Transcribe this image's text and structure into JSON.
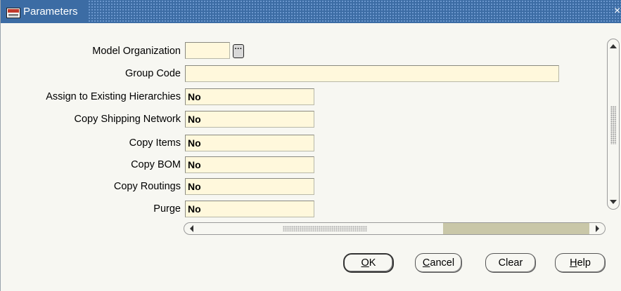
{
  "window": {
    "title": "Parameters",
    "close_glyph": "×",
    "icon": "oracle-forms-icon"
  },
  "form": {
    "model_organization": {
      "label": "Model Organization",
      "value": "",
      "lov_glyph": "···"
    },
    "group_code": {
      "label": "Group Code",
      "value": ""
    },
    "assign_to_existing_hierarchies": {
      "label": "Assign to Existing Hierarchies",
      "value": "No"
    },
    "copy_shipping_network": {
      "label": "Copy Shipping Network",
      "value": "No"
    },
    "copy_items": {
      "label": "Copy Items",
      "value": "No"
    },
    "copy_bom": {
      "label": "Copy BOM",
      "value": "No"
    },
    "copy_routings": {
      "label": "Copy Routings",
      "value": "No"
    },
    "purge": {
      "label": "Purge",
      "value": "No"
    }
  },
  "buttons": {
    "ok": {
      "mnemonic": "O",
      "rest": "K"
    },
    "cancel": {
      "mnemonic": "C",
      "rest": "ancel"
    },
    "clear": {
      "mnemonic": "",
      "rest": "Clear"
    },
    "help": {
      "mnemonic": "H",
      "rest": "elp"
    }
  },
  "colors": {
    "titlebar": "#3c6ca4",
    "window_bg": "#f7f7f2",
    "field_bg": "#fff8dc",
    "scroll_thumb": "#c9c7a8"
  }
}
